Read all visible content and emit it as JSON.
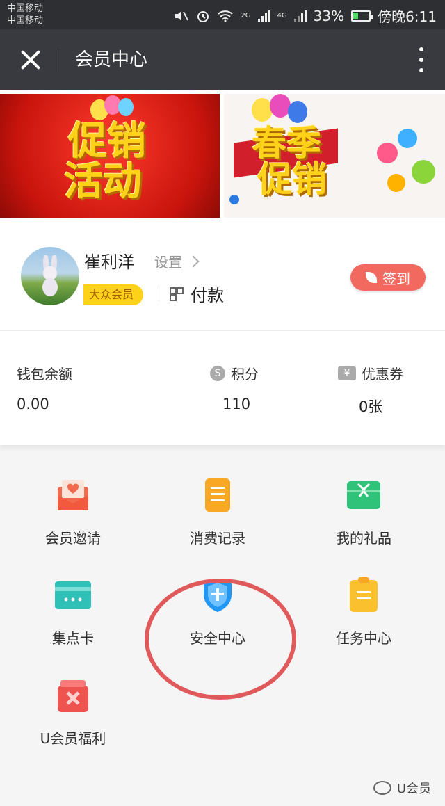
{
  "status_bar": {
    "carrier_1": "中国移动",
    "carrier_2": "中国移动",
    "network_2g": "2G",
    "network_4g": "4G",
    "battery_percent": "33%",
    "battery_level": 0.33,
    "time": "傍晚6:11"
  },
  "titlebar": {
    "title": "会员中心",
    "close_icon": "close-icon",
    "more_icon": "more-vertical-icon"
  },
  "banner": {
    "slide_1_text_line_1": "促销",
    "slide_1_text_line_2": "活动",
    "slide_2_text_line_1": "春季",
    "slide_2_text_line_2": "促销",
    "active_slide": 2
  },
  "profile": {
    "name": "崔利洋",
    "settings_label": "设置",
    "level": "大众会员",
    "pay_label": "付款",
    "checkin_label": "签到"
  },
  "stats": {
    "wallet_label": "钱包余额",
    "wallet_value": "0.00",
    "points_icon_glyph": "S",
    "points_label": "积分",
    "points_value": "110",
    "coupon_icon_glyph": "¥",
    "coupon_label": "优惠券",
    "coupon_value": "0张"
  },
  "menu": [
    {
      "label": "会员邀请",
      "icon": "envelope-heart-icon",
      "color": "#f36b4e"
    },
    {
      "label": "消费记录",
      "icon": "receipt-icon",
      "color": "#f9a825"
    },
    {
      "label": "我的礼品",
      "icon": "gift-box-icon",
      "color": "#2fc37a"
    },
    {
      "label": "集点卡",
      "icon": "card-icon",
      "color": "#2fc0b8"
    },
    {
      "label": "安全中心",
      "icon": "shield-icon",
      "color": "#2196f3"
    },
    {
      "label": "任务中心",
      "icon": "clipboard-icon",
      "color": "#fbc02d"
    },
    {
      "label": "U会员福利",
      "icon": "gift-bag-icon",
      "color": "#ef5350"
    }
  ],
  "watermark": {
    "text": "U会员"
  },
  "colors": {
    "titlebar_bg": "#393a3f",
    "checkin_bg": "#f26a5f",
    "level_badge_bg": "#ffd21a",
    "highlight_ring": "#e05a5c"
  }
}
